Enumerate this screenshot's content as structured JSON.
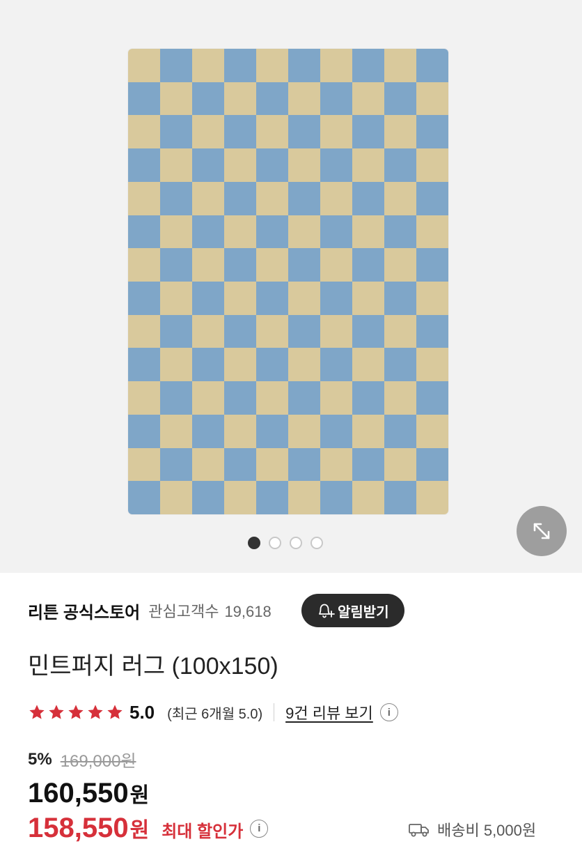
{
  "gallery": {
    "image_alt": "checkered rug",
    "rug_colors": {
      "beige": "#d9c99c",
      "blue": "#7fa6c8"
    },
    "dots_total": 4,
    "active_index": 0,
    "zoom_icon": "expand-arrows-icon"
  },
  "store": {
    "name": "리튼 공식스토어",
    "followers_label": "관심고객수",
    "followers_count": "19,618",
    "alarm_button": "알림받기",
    "alarm_icon": "bell-plus-icon"
  },
  "product": {
    "title": "민트퍼지 러그 (100x150)"
  },
  "rating": {
    "stars": 5,
    "star_color": "#d6303a",
    "value": "5.0",
    "recent": "(최근 6개월 5.0)",
    "review_link": "9건 리뷰 보기"
  },
  "pricing": {
    "discount_rate": "5%",
    "original_price": "169,000원",
    "price": "160,550",
    "price_unit": "원",
    "max_price": "158,550",
    "max_unit": "원",
    "max_label": "최대 할인가",
    "accent": "#d6303a"
  },
  "shipping": {
    "text": "배송비 5,000원",
    "icon": "truck-icon"
  }
}
